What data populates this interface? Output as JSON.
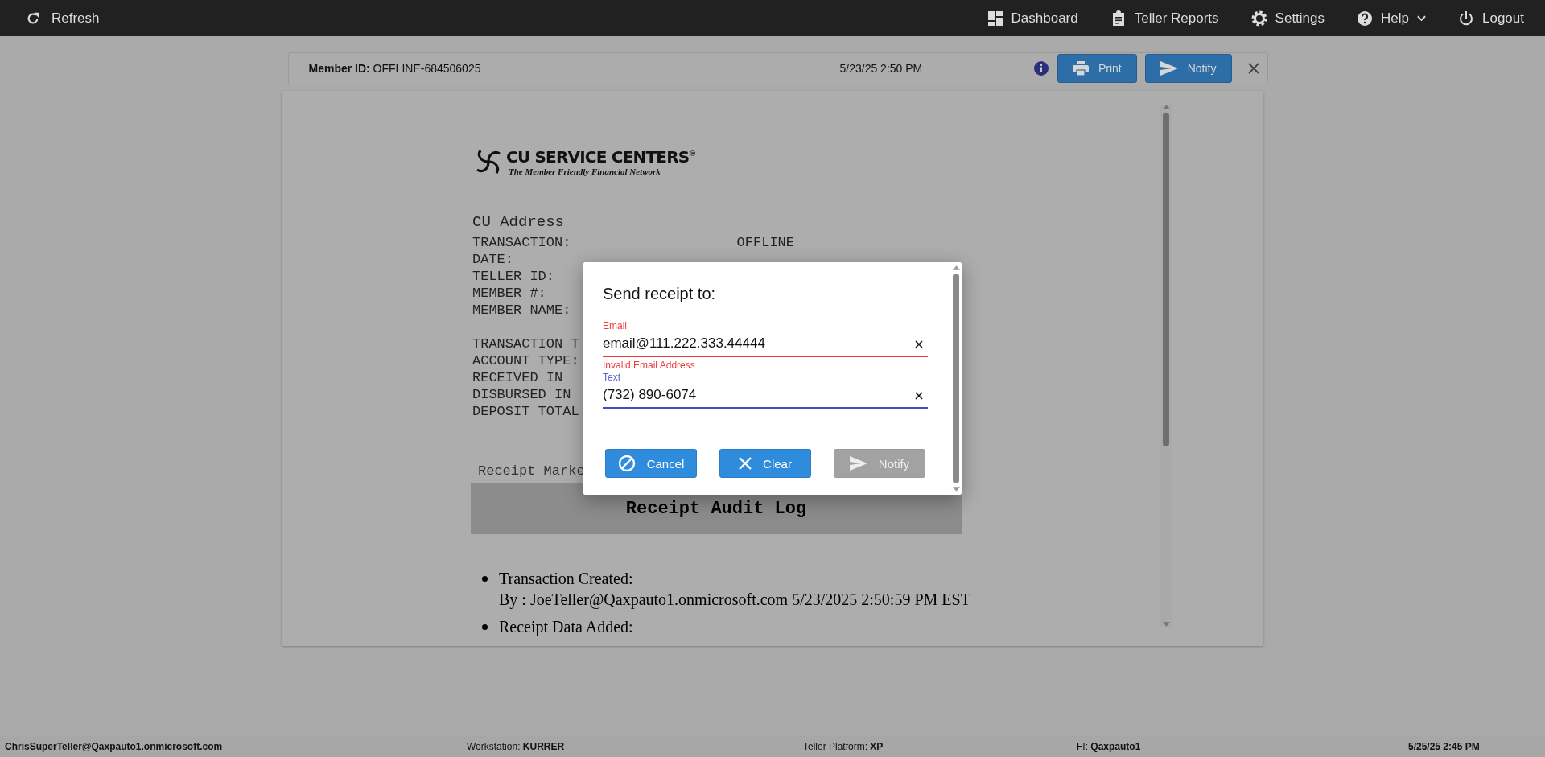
{
  "top_bar": {
    "refresh": {
      "label": "Refresh"
    },
    "nav": [
      {
        "label": "Dashboard",
        "kind": "dashboard"
      },
      {
        "label": "Teller Reports",
        "kind": "reports"
      },
      {
        "label": "Settings",
        "kind": "settings"
      },
      {
        "label": "Help",
        "kind": "help",
        "dropdown": true
      },
      {
        "label": "Logout",
        "kind": "logout"
      }
    ]
  },
  "member_bar": {
    "member_id_label": "Member ID:",
    "member_id": "OFFLINE-684506025",
    "datetime": "5/23/25 2:50 PM",
    "buttons": [
      {
        "label": "Print",
        "kind": "print"
      },
      {
        "label": "Notify",
        "kind": "notify"
      }
    ]
  },
  "receipt": {
    "logo": {
      "name": "CU SERVICE CENTERS$^{®}$",
      "tagline": "The Member Friendly Financial Network"
    },
    "address": "CU Address",
    "header_lines": [
      {
        "label": "TRANSACTION:",
        "value": "OFFLINE"
      },
      {
        "label": "DATE:"
      },
      {
        "label": "TELLER ID:"
      },
      {
        "label": "MEMBER #:"
      },
      {
        "label": "MEMBER NAME:"
      }
    ],
    "detail_lines": [
      {
        "label": "TRANSACTION T"
      },
      {
        "label": "ACCOUNT TYPE:"
      },
      {
        "label": "RECEIVED IN"
      },
      {
        "label": "DISBURSED IN"
      },
      {
        "label": "DEPOSIT TOTAL"
      }
    ],
    "marketing": "Receipt Marke",
    "audit_title": "Receipt Audit Log",
    "audit": [
      {
        "event": "Transaction Created:",
        "detail": "By : JoeTeller@Qaxpauto1.onmicrosoft.com 5/23/2025 2:50:59 PM EST"
      },
      {
        "event": "Receipt Data Added:"
      }
    ]
  },
  "dialog": {
    "title": "Send receipt to:",
    "fields": [
      {
        "label": "Email",
        "value": "email@111.222.333.44444",
        "invalid": true,
        "focused": false,
        "error": "Invalid Email Address"
      },
      {
        "label": "Text",
        "value": "(732) 890-6074",
        "invalid": false,
        "focused": true
      }
    ],
    "buttons": [
      {
        "label": "Cancel",
        "kind": "cancel",
        "disabled": false
      },
      {
        "label": "Clear",
        "kind": "clear",
        "disabled": false
      },
      {
        "label": "Notify",
        "kind": "notify",
        "disabled": true
      }
    ]
  },
  "status_bar": {
    "user": "ChrisSuperTeller@Qaxpauto1.onmicrosoft.com",
    "items": [
      {
        "label": "Workstation:",
        "value": "KURRER"
      },
      {
        "label": "Teller Platform:",
        "value": "XP"
      },
      {
        "label": "FI:",
        "value": "Qaxpauto1"
      }
    ],
    "datetime": "5/25/25 2:45 PM"
  }
}
